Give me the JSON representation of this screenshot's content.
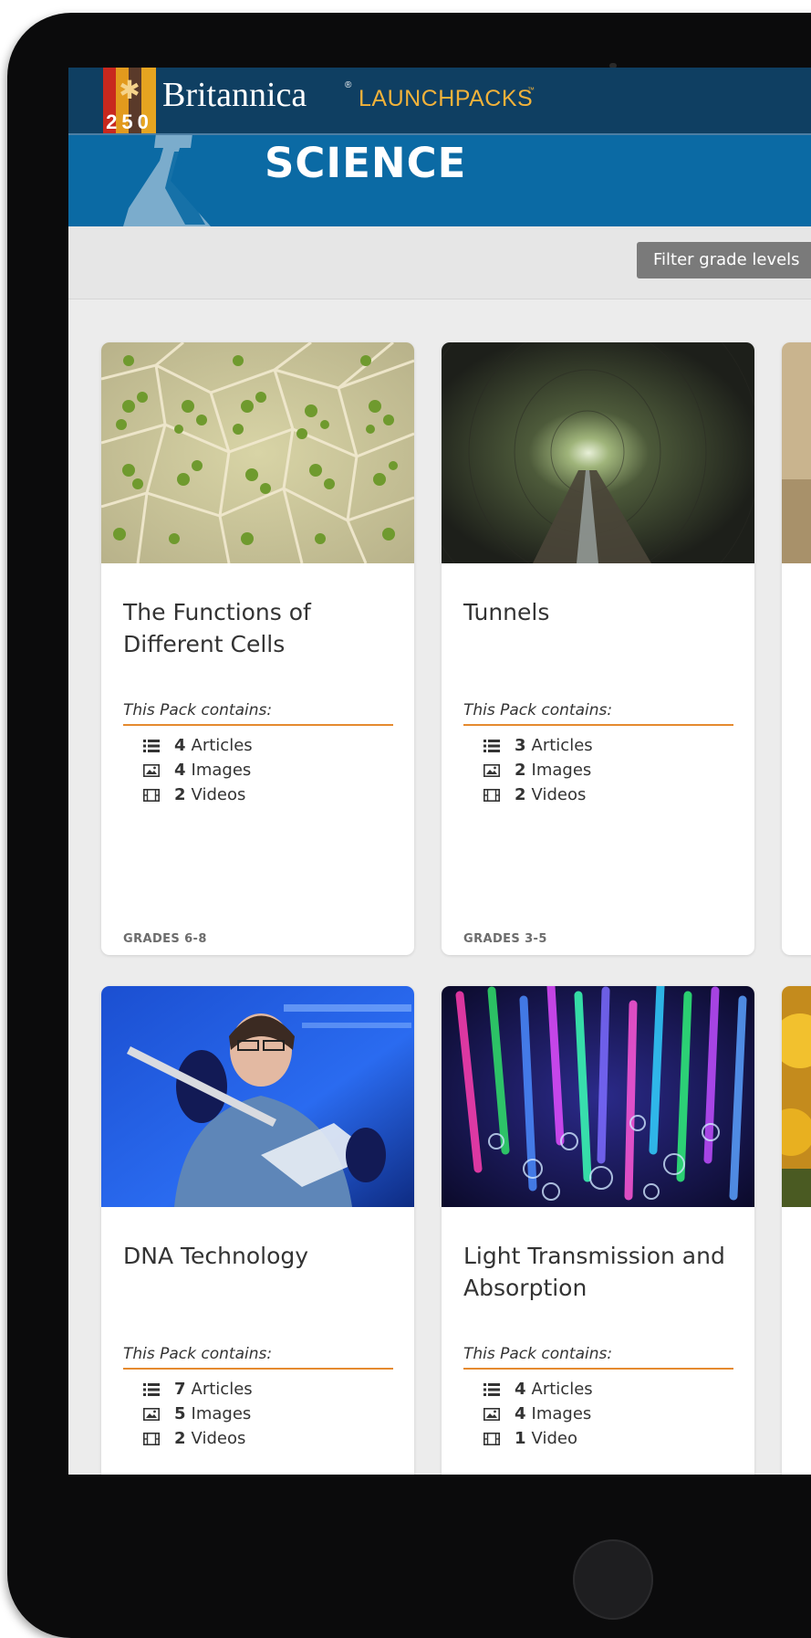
{
  "brand": {
    "badge_number": "250",
    "name": "Britannica",
    "registered_mark": "®",
    "product": "LAUNCHPACKS",
    "trademark": "™"
  },
  "subject": {
    "title": "SCIENCE"
  },
  "filter": {
    "label": "Filter grade levels"
  },
  "pack_labels": {
    "contains": "This Pack contains:"
  },
  "cards": [
    {
      "title": "The Functions of Different Cells",
      "grade": "GRADES 6-8",
      "image": "plant-cells-photo",
      "stats": [
        {
          "count": "4",
          "label": "Articles",
          "icon": "list-icon"
        },
        {
          "count": "4",
          "label": "Images",
          "icon": "image-icon"
        },
        {
          "count": "2",
          "label": "Videos",
          "icon": "film-icon"
        }
      ]
    },
    {
      "title": "Tunnels",
      "grade": "GRADES 3-5",
      "image": "tunnel-photo",
      "stats": [
        {
          "count": "3",
          "label": "Articles",
          "icon": "list-icon"
        },
        {
          "count": "2",
          "label": "Images",
          "icon": "image-icon"
        },
        {
          "count": "2",
          "label": "Videos",
          "icon": "film-icon"
        }
      ]
    },
    {
      "title": "DNA Technology",
      "image": "lab-scientist-photo",
      "stats": [
        {
          "count": "7",
          "label": "Articles",
          "icon": "list-icon"
        },
        {
          "count": "5",
          "label": "Images",
          "icon": "image-icon"
        },
        {
          "count": "2",
          "label": "Videos",
          "icon": "film-icon"
        }
      ]
    },
    {
      "title": "Light Transmission and Absorption",
      "image": "fiber-optics-photo",
      "stats": [
        {
          "count": "4",
          "label": "Articles",
          "icon": "list-icon"
        },
        {
          "count": "4",
          "label": "Images",
          "icon": "image-icon"
        },
        {
          "count": "1",
          "label": "Video",
          "icon": "film-icon"
        }
      ]
    }
  ],
  "colors": {
    "topbar": "#0f3f62",
    "subject_bar": "#0b6aa4",
    "accent_orange": "#e58a2f",
    "brand_gold": "#f2b23a"
  }
}
